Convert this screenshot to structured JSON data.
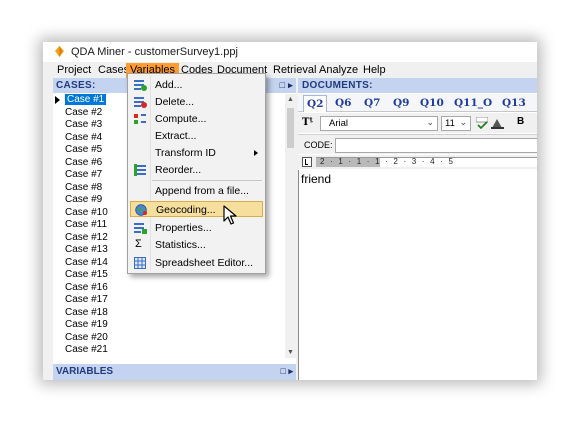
{
  "window": {
    "title": "QDA Miner - customerSurvey1.ppj"
  },
  "menubar": {
    "items": [
      "Project",
      "Cases",
      "Variables",
      "Codes",
      "Document",
      "Retrieval",
      "Analyze",
      "Help"
    ],
    "active": "Variables"
  },
  "cases_pane": {
    "header": "CASES:",
    "rows": [
      "Case #1",
      "Case #2",
      "Case #3",
      "Case #4",
      "Case #5",
      "Case #6",
      "Case #7",
      "Case #8",
      "Case #9",
      "Case #10",
      "Case #11",
      "Case #12",
      "Case #13",
      "Case #14",
      "Case #15",
      "Case #16",
      "Case #17",
      "Case #18",
      "Case #19",
      "Case #20",
      "Case #21"
    ],
    "selected_row": "Case #1"
  },
  "variables_pane": {
    "header": "VARIABLES"
  },
  "documents_pane": {
    "header": "DOCUMENTS:",
    "tabs": [
      "Q2",
      "Q6",
      "Q7",
      "Q9",
      "Q10",
      "Q11_O",
      "Q13"
    ],
    "active_tab": "Q2",
    "font_name": "Arial",
    "font_size": "11",
    "code_label": "CODE:",
    "ruler_text": "2 · 1 · 1 · 1 · 2 · 3 · 4 · 5",
    "body_text": "friend"
  },
  "variables_menu": {
    "items": [
      {
        "label": "Add...",
        "icon": "add-variable-icon"
      },
      {
        "label": "Delete...",
        "icon": "delete-variable-icon"
      },
      {
        "label": "Compute...",
        "icon": "compute-icon"
      },
      {
        "label": "Extract...",
        "icon": ""
      },
      {
        "label": "Transform ID",
        "icon": "",
        "submenu": true
      },
      {
        "label": "Reorder...",
        "icon": "reorder-icon"
      },
      {
        "label": "Append from a file...",
        "icon": ""
      },
      {
        "label": "Geocoding...",
        "icon": "globe-icon",
        "hover": true
      },
      {
        "label": "Properties...",
        "icon": "properties-icon"
      },
      {
        "label": "Statistics...",
        "icon": "sigma-icon"
      },
      {
        "label": "Spreadsheet Editor...",
        "icon": "spreadsheet-icon"
      }
    ]
  },
  "colors": {
    "menu_active": "#ff9c2e",
    "pane_header_bg": "#c3d3f0",
    "pane_header_text": "#213b7d",
    "selection": "#0078d7",
    "menu_hover": "#f6df9c"
  }
}
